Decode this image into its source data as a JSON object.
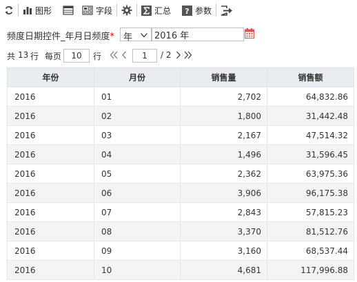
{
  "toolbar": {
    "chart_label": "图形",
    "field_label": "字段",
    "summary_label": "汇总",
    "param_label": "参数"
  },
  "filter": {
    "label": "频度日期控件_年月日频度",
    "required_mark": "*",
    "frequency_value": "年",
    "date_value": "2016 年"
  },
  "pager": {
    "total_prefix": "共",
    "total_count": "13",
    "total_suffix": "行",
    "page_size_label": "每页",
    "page_size": "10",
    "page_size_suffix": "行",
    "current_page": "1",
    "total_pages": "/ 2"
  },
  "table": {
    "columns": [
      "年份",
      "月份",
      "销售量",
      "销售额"
    ],
    "rows": [
      [
        "2016",
        "01",
        "2,702",
        "64,832.86"
      ],
      [
        "2016",
        "02",
        "1,800",
        "31,442.48"
      ],
      [
        "2016",
        "03",
        "2,167",
        "47,514.32"
      ],
      [
        "2016",
        "04",
        "1,496",
        "31,596.45"
      ],
      [
        "2016",
        "05",
        "2,362",
        "63,975.36"
      ],
      [
        "2016",
        "06",
        "3,906",
        "96,175.38"
      ],
      [
        "2016",
        "07",
        "2,843",
        "57,815.23"
      ],
      [
        "2016",
        "08",
        "3,370",
        "81,512.76"
      ],
      [
        "2016",
        "09",
        "3,160",
        "68,537.44"
      ],
      [
        "2016",
        "10",
        "4,681",
        "117,996.88"
      ]
    ]
  },
  "colors": {
    "header_bg": "#e9edf1",
    "stripe_bg": "#f4f4f4",
    "icon_dark": "#444444",
    "required": "#e60000",
    "calendar": "#d9534f"
  }
}
